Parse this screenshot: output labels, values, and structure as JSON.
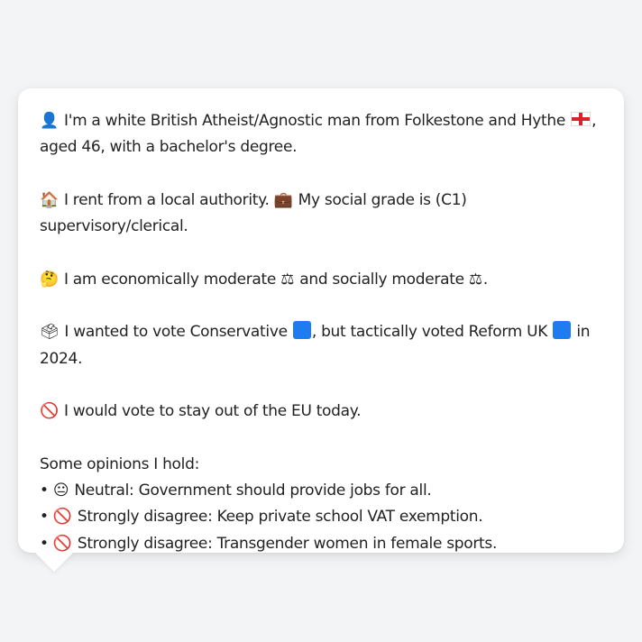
{
  "profile": {
    "line1": {
      "icon": "person-silhouette-icon",
      "text_a": "I'm a white British Atheist/Agnostic man from Folkestone and Hythe",
      "flag": "england-flag-icon",
      "text_b": ",",
      "text_c": "aged 46, with a bachelor's degree."
    },
    "line2": {
      "icon_a": "house-icon",
      "text_a": "I rent from a local authority.",
      "icon_b": "briefcase-icon",
      "text_b": "My social grade is (C1) supervisory/clerical."
    },
    "line3": {
      "icon": "thinking-face-icon",
      "text_a": "I am economically moderate",
      "scale_icon": "balance-scale-icon",
      "text_b": "and socially moderate",
      "text_c": "."
    },
    "line4": {
      "icon": "ballot-box-icon",
      "text_a": "I wanted to vote Conservative",
      "text_b": ", but tactically voted Reform UK",
      "text_c": "in",
      "text_d": "2024.",
      "party_color": "#1e7cf0"
    },
    "line5": {
      "icon": "prohibited-icon",
      "text": "I would vote to stay out of the EU today."
    },
    "opinions": {
      "heading": "Some opinions I hold:",
      "items": [
        {
          "bullet": "•",
          "icon": "neutral-face-icon",
          "text": "Neutral: Government should provide jobs for all."
        },
        {
          "bullet": "•",
          "icon": "prohibited-icon",
          "text": "Strongly disagree: Keep private school VAT exemption."
        },
        {
          "bullet": "•",
          "icon": "prohibited-icon",
          "text": "Strongly disagree: Transgender women in female sports."
        }
      ]
    }
  }
}
